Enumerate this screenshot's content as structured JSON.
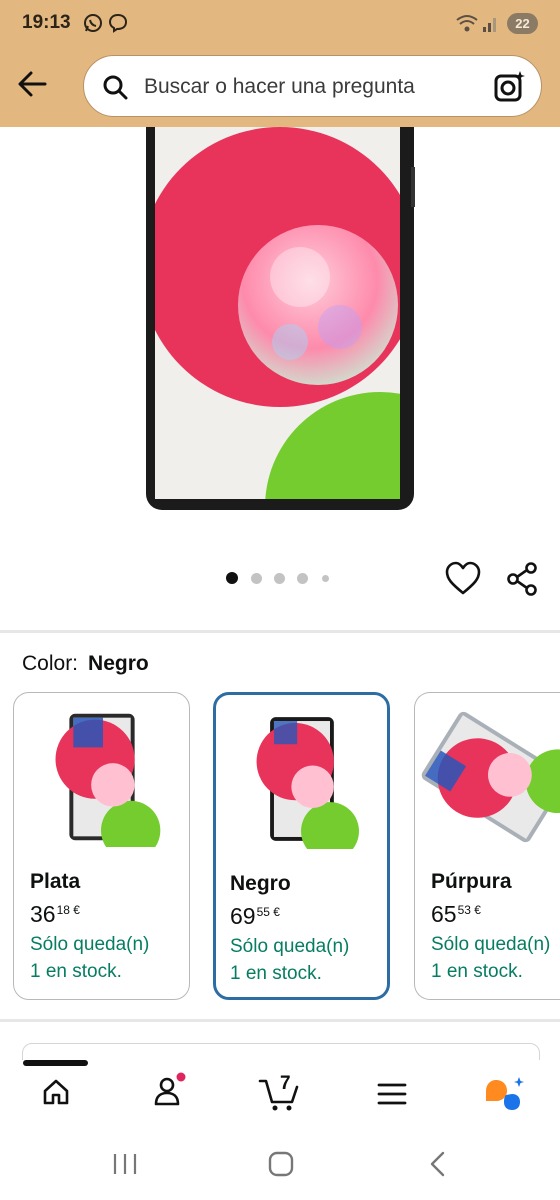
{
  "status_bar": {
    "time": "19:13",
    "battery": "22"
  },
  "search": {
    "placeholder": "Buscar o hacer una pregunta"
  },
  "gallery": {
    "dot_count": 5,
    "active_dot": 0
  },
  "color": {
    "label": "Color:",
    "selected": "Negro",
    "options": [
      {
        "name": "Plata",
        "price_whole": "36",
        "price_fraction": "18 €",
        "stock_line1": "Sólo queda(n)",
        "stock_line2": "1 en stock."
      },
      {
        "name": "Negro",
        "price_whole": "69",
        "price_fraction": "55 €",
        "stock_line1": "Sólo queda(n)",
        "stock_line2": "1 en stock."
      },
      {
        "name": "Púrpura",
        "price_whole": "65",
        "price_fraction": "53 €",
        "stock_line1": "Sólo queda(n)",
        "stock_line2": "1 en stock."
      }
    ]
  },
  "bottom_nav": {
    "cart_count": "7"
  },
  "colors": {
    "header": "#e3b780",
    "stock_green": "#067d62",
    "selected_border": "#2e6da4",
    "notify_dot": "#e0245e"
  },
  "icons": [
    "whatsapp-icon",
    "messenger-icon",
    "wifi-icon",
    "signal-icon",
    "back-arrow-icon",
    "search-icon",
    "camera-lens-icon",
    "heart-icon",
    "share-icon",
    "home-icon",
    "account-icon",
    "cart-icon",
    "menu-icon",
    "rufus-icon"
  ]
}
